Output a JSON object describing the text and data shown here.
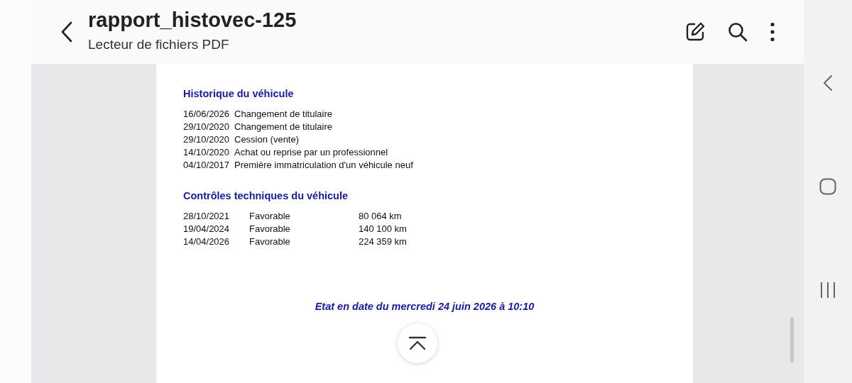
{
  "header": {
    "title": "rapport_histovec-125",
    "subtitle": "Lecteur de fichiers PDF"
  },
  "document": {
    "history": {
      "heading": "Historique du véhicule",
      "rows": [
        {
          "date": "16/06/2026",
          "event": "Changement de titulaire"
        },
        {
          "date": "29/10/2020",
          "event": "Changement de titulaire"
        },
        {
          "date": "29/10/2020",
          "event": "Cession (vente)"
        },
        {
          "date": "14/10/2020",
          "event": "Achat ou reprise par un professionnel"
        },
        {
          "date": "04/10/2017",
          "event": "Première immatriculation d'un véhicule neuf"
        }
      ]
    },
    "inspections": {
      "heading": "Contrôles techniques du véhicule",
      "rows": [
        {
          "date": "28/10/2021",
          "result": "Favorable",
          "mileage": "80 064 km"
        },
        {
          "date": "19/04/2024",
          "result": "Favorable",
          "mileage": "140 100 km"
        },
        {
          "date": "14/04/2026",
          "result": "Favorable",
          "mileage": "224 359 km"
        }
      ]
    },
    "footer": "Etat en date du mercredi 24 juin 2026 à 10:10"
  }
}
